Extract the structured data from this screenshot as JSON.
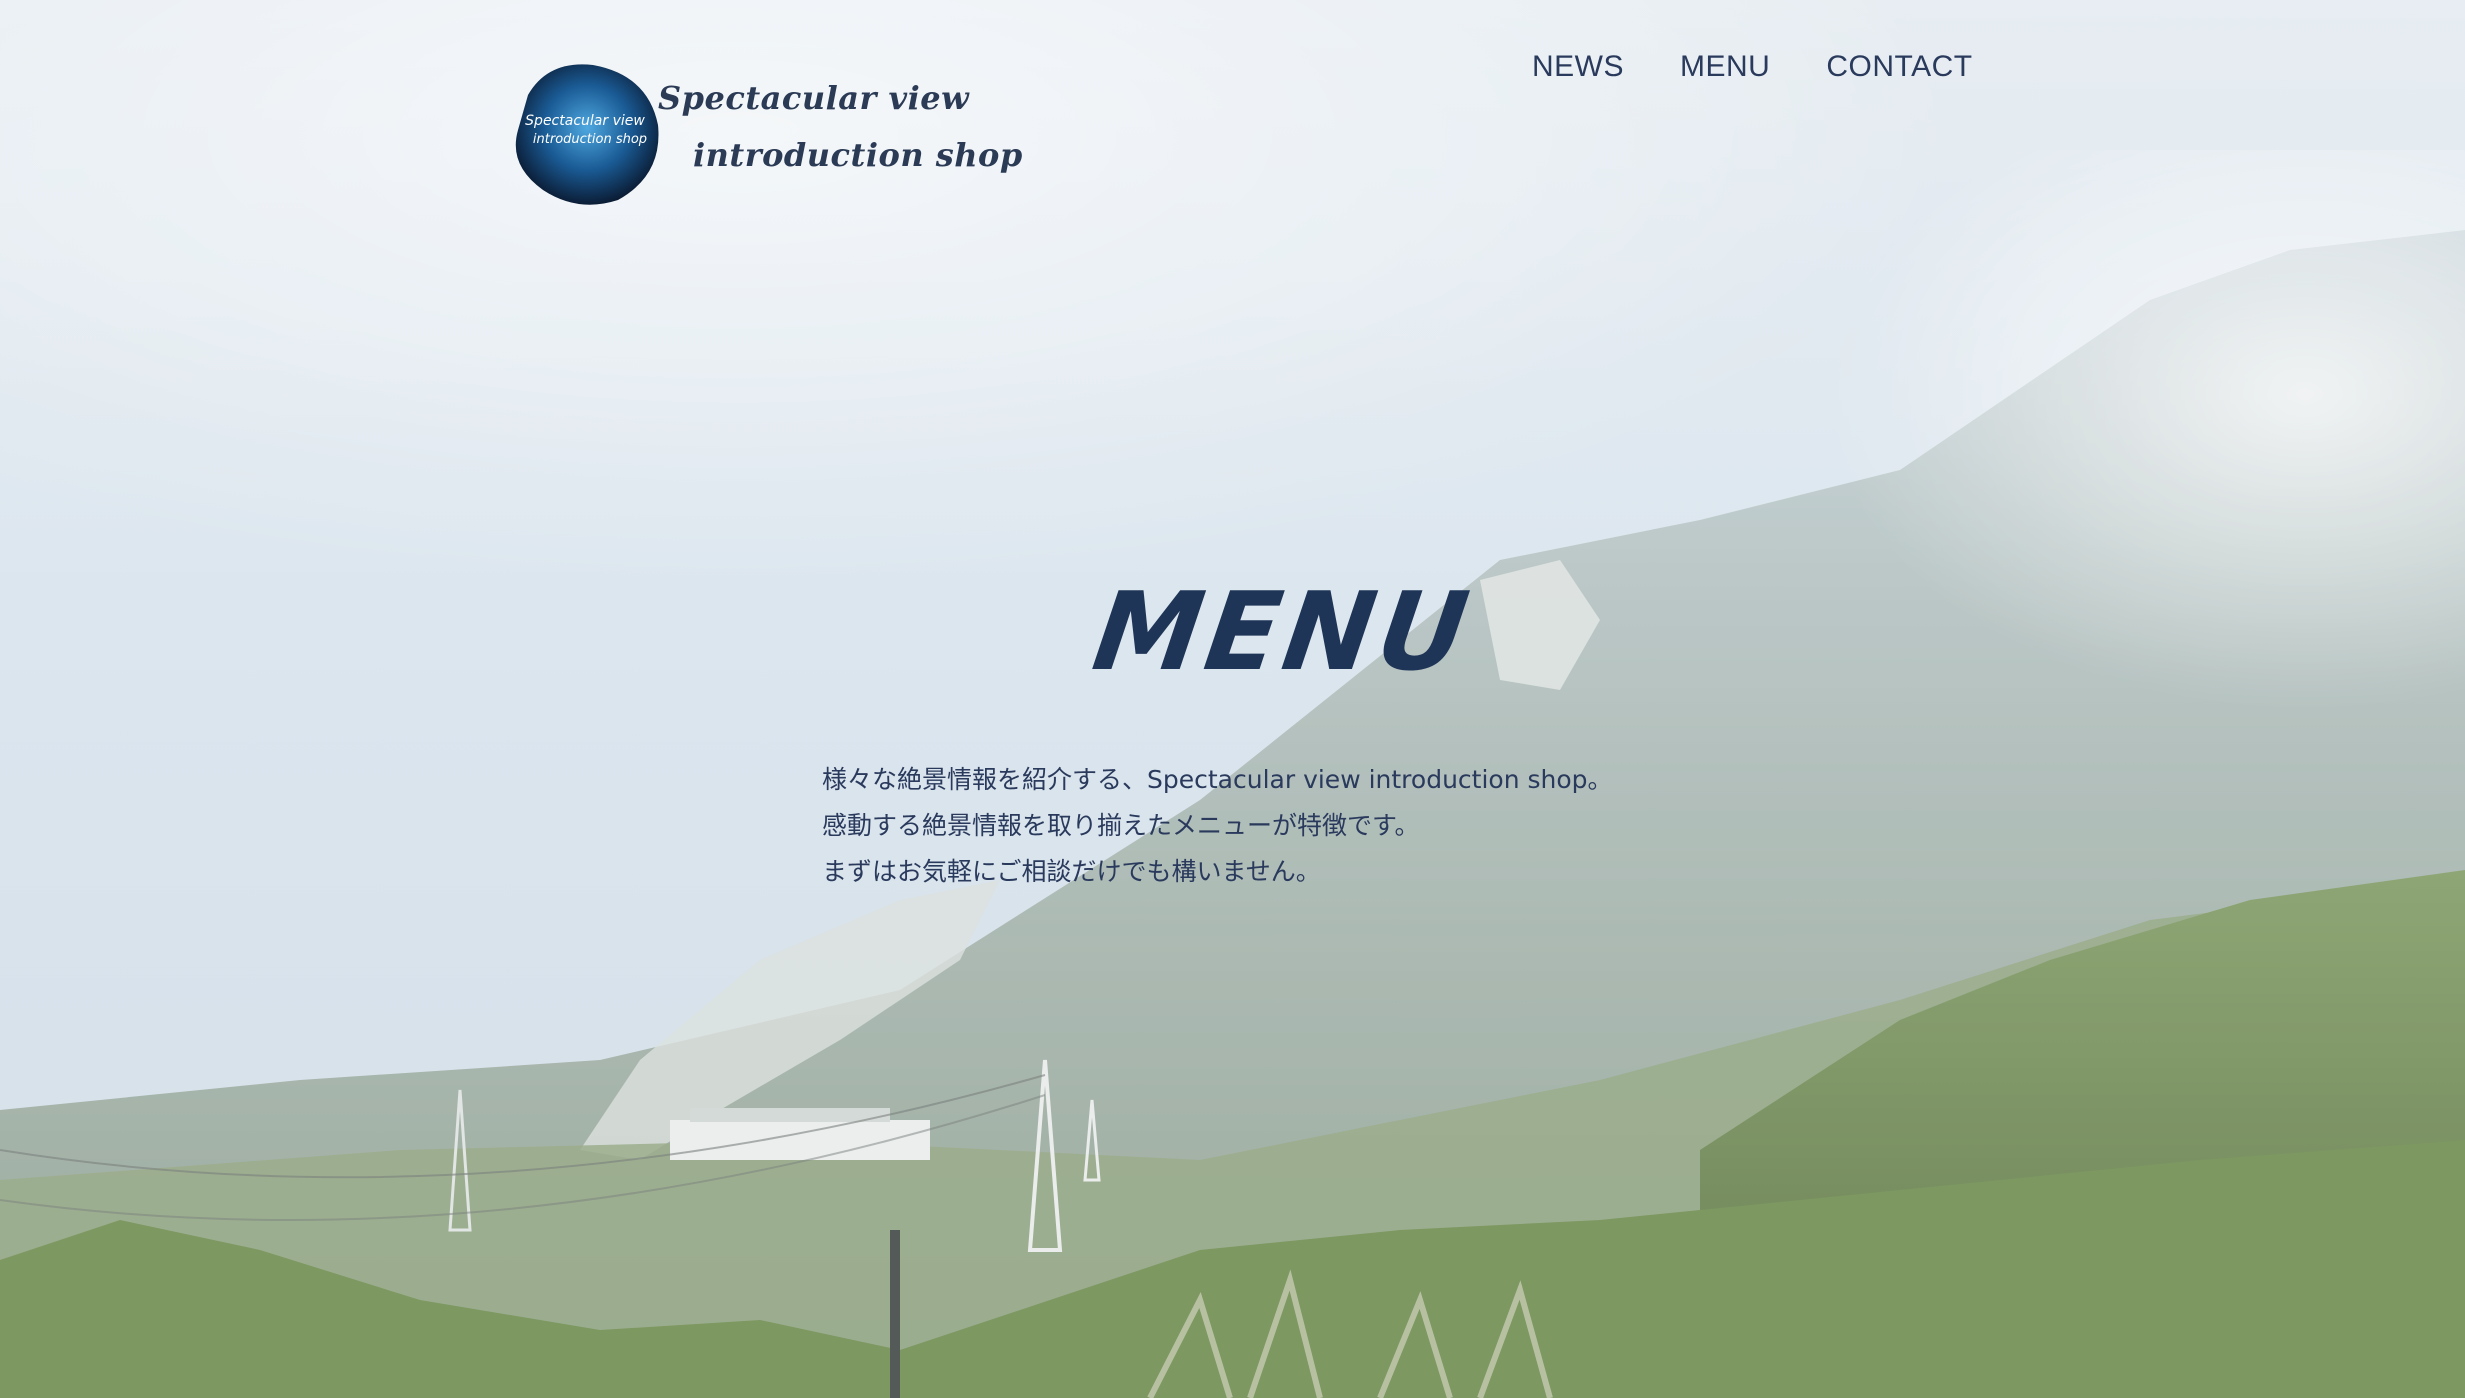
{
  "brand": {
    "logo_line1": "Spectacular view",
    "logo_line2": "introduction shop",
    "badge_line1": "Spectacular view",
    "badge_line2": "introduction shop"
  },
  "nav": {
    "items": [
      {
        "label": "NEWS"
      },
      {
        "label": "MENU"
      },
      {
        "label": "CONTACT"
      }
    ]
  },
  "hero": {
    "title": "MENU",
    "intro_lines": [
      "様々な絶景情報を紹介する、Spectacular view introduction shop。",
      "感動する絶景情報を取り揃えたメニューが特徴です。",
      "まずはお気軽にご相談だけでも構いません。"
    ]
  },
  "colors": {
    "text_primary": "#1f3557",
    "nav_text": "#2a3a5c",
    "sky": "#dde7ef",
    "mountain": "#9fb0aa",
    "forest": "#5e7a46"
  }
}
